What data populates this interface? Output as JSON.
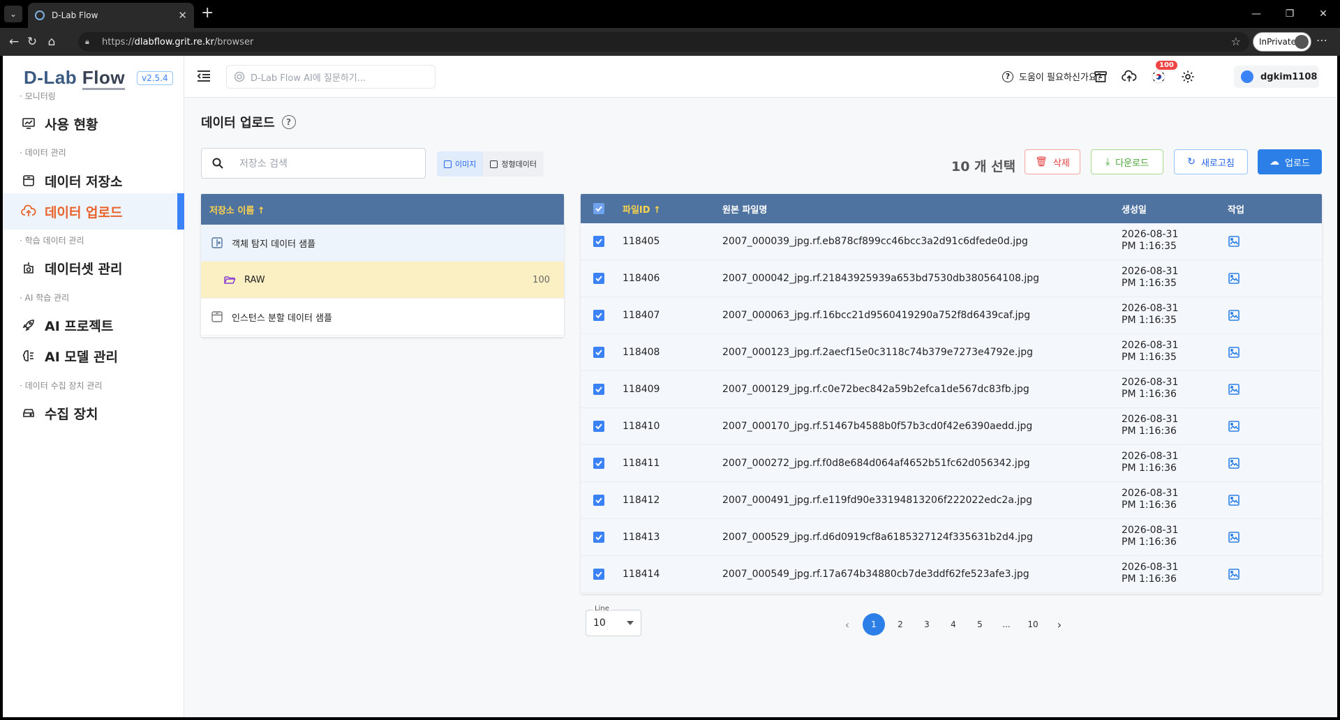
{
  "browser": {
    "tab_title": "D-Lab Flow",
    "url_prefix": "https://",
    "url_host": "dlabflow.grit.re.kr",
    "url_path": "/browser",
    "inprivate_label": "InPrivate"
  },
  "app": {
    "logo_main": "D-Lab ",
    "logo_flow": "Flow",
    "version": "v2.5.4"
  },
  "sidebar": {
    "sections": [
      {
        "label": "· 모니터링"
      },
      {
        "label": "· 데이터 관리"
      },
      {
        "label": "· 학습 데이터 관리"
      },
      {
        "label": "· AI 학습 관리"
      },
      {
        "label": "· 데이터 수집 장치 관리"
      }
    ],
    "items": [
      {
        "label": "사용 현황",
        "icon": "monitor-chart-icon"
      },
      {
        "label": "데이터 저장소",
        "icon": "storage-icon"
      },
      {
        "label": "데이터 업로드",
        "icon": "cloud-upload-icon"
      },
      {
        "label": "데이터셋 관리",
        "icon": "dataset-icon"
      },
      {
        "label": "AI 프로젝트",
        "icon": "rocket-icon"
      },
      {
        "label": "AI 모델 관리",
        "icon": "brain-icon"
      },
      {
        "label": "수집 장치",
        "icon": "device-icon"
      }
    ]
  },
  "header": {
    "ai_placeholder": "D-Lab Flow AI에 질문하기...",
    "help_label": "도움이 필요하신가요?",
    "upload_badge": "100",
    "username": "dgkim1108"
  },
  "page": {
    "title": "데이터 업로드",
    "repo_search_placeholder": "저장소 검색",
    "type_image": "이미지",
    "type_structured": "정형데이터",
    "selected_count": "10 개 선택",
    "btn_delete": "삭제",
    "btn_download": "다운로드",
    "btn_refresh": "새로고침",
    "btn_upload": "업로드"
  },
  "repos": {
    "header": "저장소 이름 ↑",
    "rows": [
      {
        "name": "객체 탐지 데이터 샘플"
      },
      {
        "name": "RAW",
        "count": "100"
      },
      {
        "name": "인스턴스 분할 데이터 샘플"
      }
    ]
  },
  "files": {
    "columns": {
      "id": "파일ID ↑",
      "name": "원본 파일명",
      "created": "생성일",
      "action": "작업"
    },
    "rows": [
      {
        "id": "118405",
        "name": "2007_000039_jpg.rf.eb878cf899cc46bcc3a2d91c6dfede0d.jpg",
        "date": "2026-08-31",
        "time": "PM 1:16:35"
      },
      {
        "id": "118406",
        "name": "2007_000042_jpg.rf.21843925939a653bd7530db380564108.jpg",
        "date": "2026-08-31",
        "time": "PM 1:16:35"
      },
      {
        "id": "118407",
        "name": "2007_000063_jpg.rf.16bcc21d9560419290a752f8d6439caf.jpg",
        "date": "2026-08-31",
        "time": "PM 1:16:35"
      },
      {
        "id": "118408",
        "name": "2007_000123_jpg.rf.2aecf15e0c3118c74b379e7273e4792e.jpg",
        "date": "2026-08-31",
        "time": "PM 1:16:35"
      },
      {
        "id": "118409",
        "name": "2007_000129_jpg.rf.c0e72bec842a59b2efca1de567dc83fb.jpg",
        "date": "2026-08-31",
        "time": "PM 1:16:36"
      },
      {
        "id": "118410",
        "name": "2007_000170_jpg.rf.51467b4588b0f57b3cd0f42e6390aedd.jpg",
        "date": "2026-08-31",
        "time": "PM 1:16:36"
      },
      {
        "id": "118411",
        "name": "2007_000272_jpg.rf.f0d8e684d064af4652b51fc62d056342.jpg",
        "date": "2026-08-31",
        "time": "PM 1:16:36"
      },
      {
        "id": "118412",
        "name": "2007_000491_jpg.rf.e119fd90e33194813206f222022edc2a.jpg",
        "date": "2026-08-31",
        "time": "PM 1:16:36"
      },
      {
        "id": "118413",
        "name": "2007_000529_jpg.rf.d6d0919cf8a6185327124f335631b2d4.jpg",
        "date": "2026-08-31",
        "time": "PM 1:16:36"
      },
      {
        "id": "118414",
        "name": "2007_000549_jpg.rf.17a674b34880cb7de3ddf62fe523afe3.jpg",
        "date": "2026-08-31",
        "time": "PM 1:16:36"
      }
    ]
  },
  "pagination": {
    "line_label": "Line",
    "line_value": "10",
    "pages": [
      "1",
      "2",
      "3",
      "4",
      "5",
      "...",
      "10"
    ],
    "current": "1"
  },
  "colors": {
    "accent": "#2b7fe6",
    "table_header": "#4f73a0",
    "active_menu": "#e8622c"
  }
}
